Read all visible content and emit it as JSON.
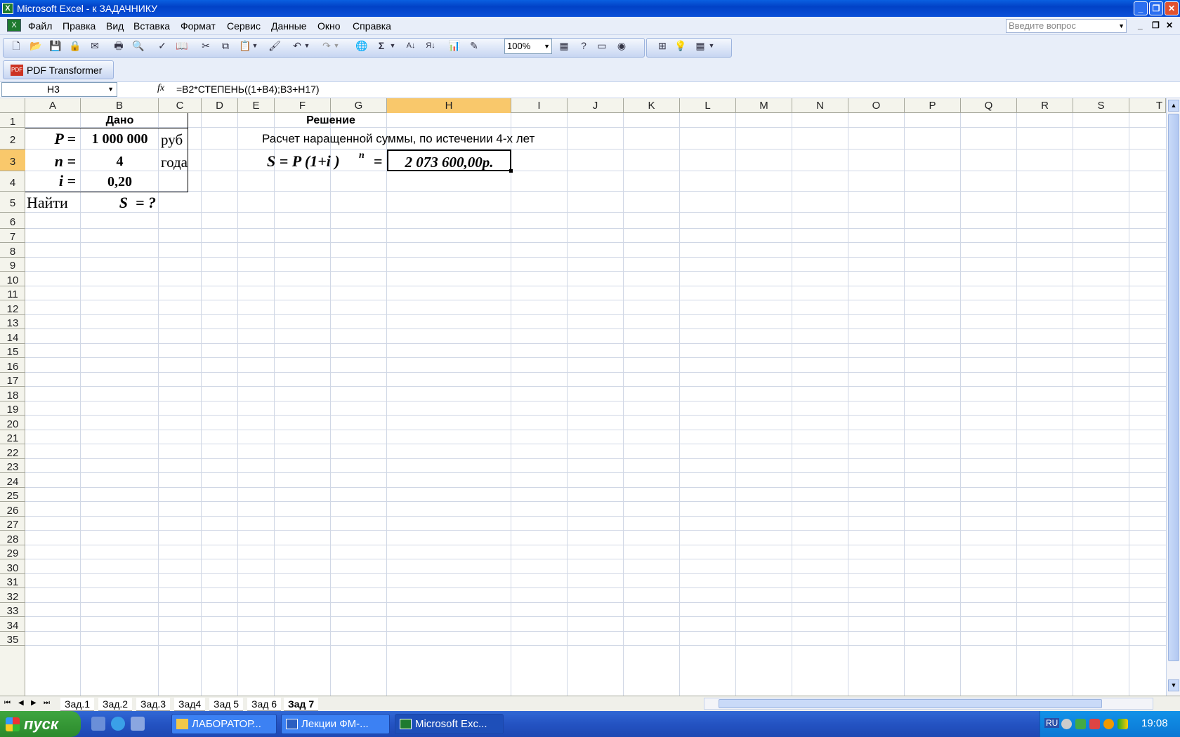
{
  "window": {
    "title": "Microsoft Excel - к ЗАДАЧНИКУ",
    "app_icon": "excel-icon"
  },
  "menu": {
    "items": [
      "Файл",
      "Правка",
      "Вид",
      "Вставка",
      "Формат",
      "Сервис",
      "Данные",
      "Окно",
      "Справка"
    ],
    "ask_placeholder": "Введите вопрос"
  },
  "toolbar": {
    "zoom": "100%",
    "pdf_label": "PDF Transformer"
  },
  "formula_bar": {
    "name_box": "H3",
    "fx": "fx",
    "formula": "=B2*СТЕПЕНЬ((1+B4);B3+H17)"
  },
  "columns": [
    "A",
    "B",
    "C",
    "D",
    "E",
    "F",
    "G",
    "H",
    "I",
    "J",
    "K",
    "L",
    "M",
    "N",
    "O",
    "P",
    "Q",
    "R",
    "S",
    "T"
  ],
  "rows": [
    "1",
    "2",
    "3",
    "4",
    "5",
    "6",
    "7",
    "8",
    "9",
    "10",
    "11",
    "12",
    "13",
    "14",
    "15",
    "16",
    "17",
    "18",
    "19",
    "20",
    "21",
    "22",
    "23",
    "24",
    "25",
    "26",
    "27",
    "28",
    "29",
    "30",
    "31",
    "32",
    "33",
    "34",
    "35"
  ],
  "selected": {
    "column": "H",
    "row": "3"
  },
  "cells": {
    "dano": "Дано",
    "p_label": "P =",
    "p_value": "1 000 000",
    "p_unit": "руб",
    "n_label": "n =",
    "n_value": "4",
    "n_unit": "года",
    "i_label": "i =",
    "i_value": "0,20",
    "find": "Найти",
    "s_query": "S  = ?",
    "resh": "Решение",
    "calc_text": "Расчет наращенной суммы, по истечении 4-х лет",
    "formula_s": "S = P (1+i )",
    "formula_exp": "n",
    "formula_eq": "=",
    "result": "2 073 600,00р."
  },
  "sheets": {
    "tabs": [
      "Зад.1",
      "Зад.2",
      "Зад.3",
      "Зад4",
      "Зад 5",
      "Зад 6",
      "Зад 7"
    ],
    "active": "Зад 7"
  },
  "taskbar": {
    "start": "пуск",
    "tasks": [
      "ЛАБОРАТОР...",
      "Лекции ФМ-...",
      "Microsoft Exc..."
    ],
    "lang": "RU",
    "clock": "19:08"
  },
  "colors": {
    "selection": "#f9c86b",
    "grid": "#d0d7e5",
    "title_blue": "#0142c7",
    "start_green": "#3fa540"
  }
}
